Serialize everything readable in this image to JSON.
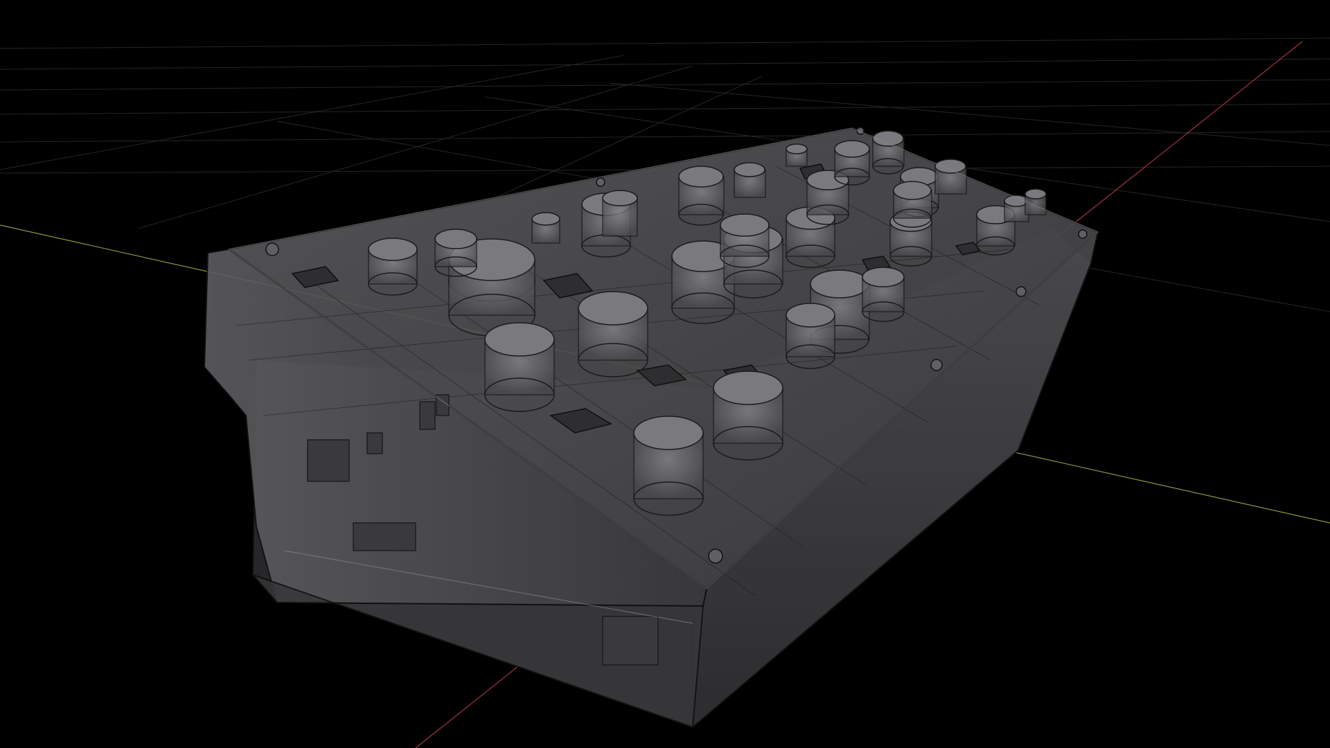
{
  "viewport": {
    "background": "#000000",
    "shading": "x-ray wireframe",
    "object": "synthesizer-enclosure",
    "colors": {
      "grid": "#2a2a2a",
      "x_axis": "#a8323e",
      "y_axis": "#8a9a3a",
      "body_fill": "#4a4a4c",
      "body_edge": "#1a1a1a",
      "knob_fill": "#6a6a6c"
    }
  }
}
